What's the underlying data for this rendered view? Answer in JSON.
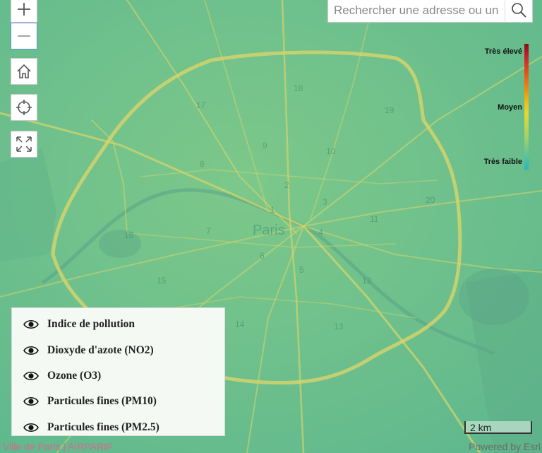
{
  "search": {
    "placeholder": "Rechercher une adresse ou un"
  },
  "controls": [
    {
      "name": "zoom-in-button",
      "icon": "plus-icon"
    },
    {
      "name": "zoom-out-button",
      "icon": "minus-icon"
    },
    {
      "name": "home-button",
      "icon": "home-icon"
    },
    {
      "name": "locate-button",
      "icon": "crosshair-icon"
    },
    {
      "name": "fullscreen-button",
      "icon": "expand-icon"
    }
  ],
  "legend": {
    "high": "Très élevé",
    "mid": "Moyen",
    "low": "Très faible",
    "colors": [
      "#8b0a12",
      "#ee6e12",
      "#e8d830",
      "#29b5c3"
    ]
  },
  "layers": [
    {
      "label": "Indice de pollution",
      "icon": "eye-icon"
    },
    {
      "label": "Dioxyde d'azote (NO2)",
      "icon": "eye-icon"
    },
    {
      "label": "Ozone (O3)",
      "icon": "eye-icon"
    },
    {
      "label": "Particules fines (PM10)",
      "icon": "eye-icon"
    },
    {
      "label": "Particules fines (PM2.5)",
      "icon": "eye-icon"
    }
  ],
  "map": {
    "city_label": "Paris",
    "arrondissements": [
      "17",
      "18",
      "19",
      "9",
      "10",
      "8",
      "2",
      "3",
      "11",
      "20",
      "16",
      "7",
      "1",
      "4",
      "6",
      "5",
      "12",
      "15",
      "14",
      "13"
    ],
    "colors": {
      "base": "#6cc08e",
      "road": "#d9d56a",
      "water": "#5aa386"
    }
  },
  "scale": {
    "label": "2 km"
  },
  "footer": {
    "attribution": "Ville de Paris | AIRPARIF",
    "powered_by": "Powered by Esri"
  }
}
